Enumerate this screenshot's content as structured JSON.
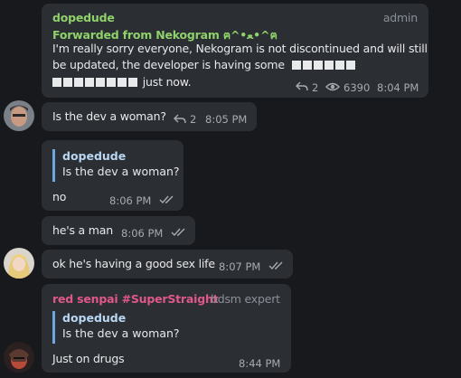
{
  "messages": [
    {
      "sender": "dopedude",
      "role": "admin",
      "forwarded": "Forwarded from Nekogram ฅ^•ﻌ•^ฅ",
      "text_line1": "I'm really sorry everyone, Nekogram is not discontinued and will still",
      "text_line2": "be updated, the developer is having some",
      "text_line3_suffix": "just now.",
      "replies": "2",
      "views": "6390",
      "time": "8:04 PM"
    },
    {
      "text": "Is the dev a woman?",
      "replies": "2",
      "time": "8:05 PM"
    },
    {
      "quote_name": "dopedude",
      "quote_text": "Is the dev a woman?",
      "text": "no",
      "time": "8:06 PM"
    },
    {
      "text": "he's a man",
      "time": "8:06 PM"
    },
    {
      "text": "ok he's having a good sex life",
      "time": "8:07 PM"
    },
    {
      "sender": "red senpai #SuperStraight",
      "role": "bdsm expert",
      "quote_name": "dopedude",
      "quote_text": "Is the dev a woman?",
      "text": "Just on drugs",
      "time": "8:44 PM"
    }
  ],
  "colors": {
    "background": "#18191c",
    "bubble": "#2b2e33",
    "sender_green": "#8fd16a",
    "sender_red": "#e0588a",
    "quote_bar": "#6ea7e0"
  },
  "icons": [
    "reply-arrow-icon",
    "eye-icon",
    "double-check-icon"
  ]
}
